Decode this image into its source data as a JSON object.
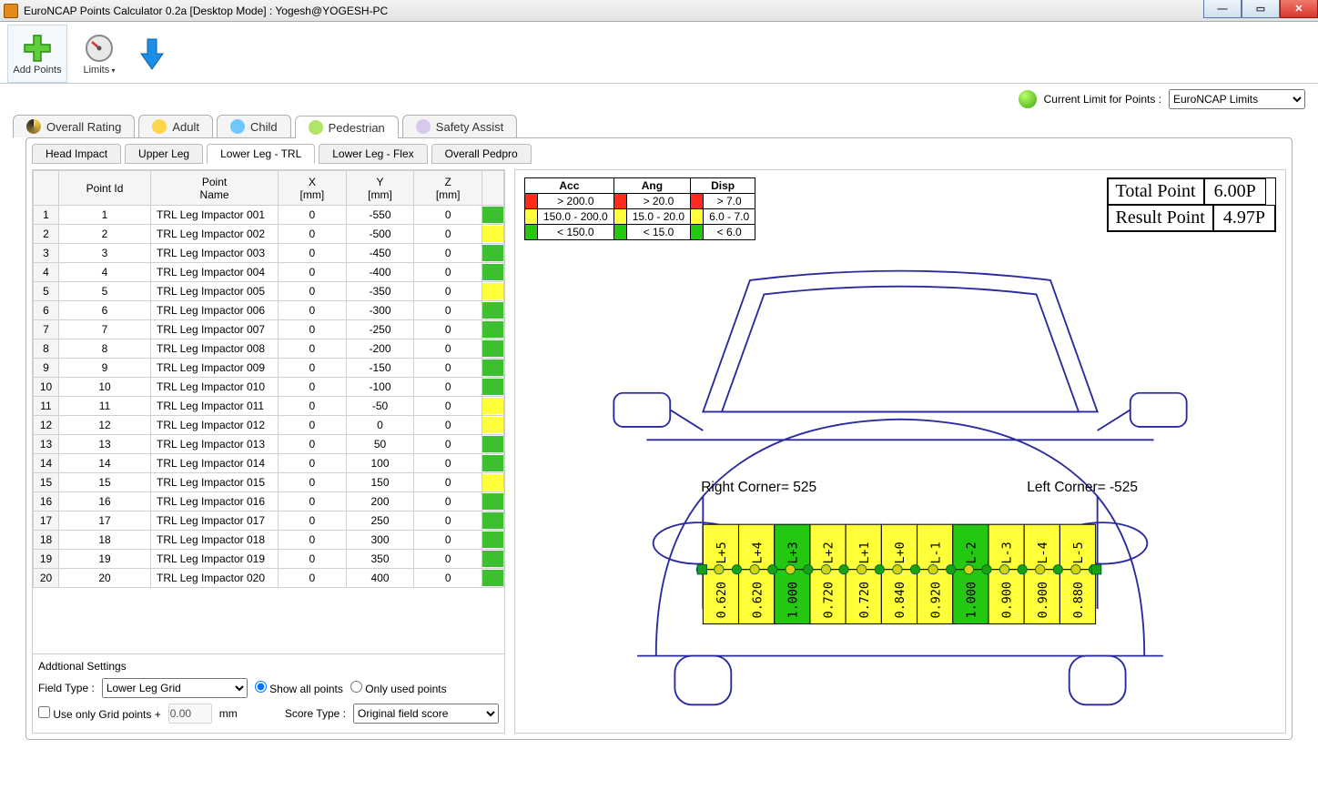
{
  "window": {
    "title": "EuroNCAP Points Calculator 0.2a [Desktop Mode] : Yogesh@YOGESH-PC"
  },
  "toolbar": {
    "add_points": "Add Points",
    "limits": "Limits"
  },
  "limit_row": {
    "label": "Current Limit for Points :",
    "selected": "EuroNCAP Limits"
  },
  "tabs": {
    "overall": "Overall Rating",
    "adult": "Adult",
    "child": "Child",
    "pedestrian": "Pedestrian",
    "safety": "Safety Assist"
  },
  "subtabs": {
    "head": "Head Impact",
    "upper": "Upper Leg",
    "trl": "Lower Leg - TRL",
    "flex": "Lower Leg - Flex",
    "overallp": "Overall Pedpro"
  },
  "table": {
    "headers": {
      "pid": "Point Id",
      "pname": "Point\nName",
      "x": "X\n[mm]",
      "y": "Y\n[mm]",
      "z": "Z\n[mm]"
    },
    "rows": [
      {
        "n": 1,
        "id": "1",
        "name": "TRL Leg Impactor 001",
        "x": "0",
        "y": "-550",
        "z": "0",
        "c": "g"
      },
      {
        "n": 2,
        "id": "2",
        "name": "TRL Leg Impactor 002",
        "x": "0",
        "y": "-500",
        "z": "0",
        "c": "y"
      },
      {
        "n": 3,
        "id": "3",
        "name": "TRL Leg Impactor 003",
        "x": "0",
        "y": "-450",
        "z": "0",
        "c": "g"
      },
      {
        "n": 4,
        "id": "4",
        "name": "TRL Leg Impactor 004",
        "x": "0",
        "y": "-400",
        "z": "0",
        "c": "g"
      },
      {
        "n": 5,
        "id": "5",
        "name": "TRL Leg Impactor 005",
        "x": "0",
        "y": "-350",
        "z": "0",
        "c": "y"
      },
      {
        "n": 6,
        "id": "6",
        "name": "TRL Leg Impactor 006",
        "x": "0",
        "y": "-300",
        "z": "0",
        "c": "g"
      },
      {
        "n": 7,
        "id": "7",
        "name": "TRL Leg Impactor 007",
        "x": "0",
        "y": "-250",
        "z": "0",
        "c": "g"
      },
      {
        "n": 8,
        "id": "8",
        "name": "TRL Leg Impactor 008",
        "x": "0",
        "y": "-200",
        "z": "0",
        "c": "g"
      },
      {
        "n": 9,
        "id": "9",
        "name": "TRL Leg Impactor 009",
        "x": "0",
        "y": "-150",
        "z": "0",
        "c": "g"
      },
      {
        "n": 10,
        "id": "10",
        "name": "TRL Leg Impactor 010",
        "x": "0",
        "y": "-100",
        "z": "0",
        "c": "g"
      },
      {
        "n": 11,
        "id": "11",
        "name": "TRL Leg Impactor 011",
        "x": "0",
        "y": "-50",
        "z": "0",
        "c": "y"
      },
      {
        "n": 12,
        "id": "12",
        "name": "TRL Leg Impactor 012",
        "x": "0",
        "y": "0",
        "z": "0",
        "c": "y"
      },
      {
        "n": 13,
        "id": "13",
        "name": "TRL Leg Impactor 013",
        "x": "0",
        "y": "50",
        "z": "0",
        "c": "g"
      },
      {
        "n": 14,
        "id": "14",
        "name": "TRL Leg Impactor 014",
        "x": "0",
        "y": "100",
        "z": "0",
        "c": "g"
      },
      {
        "n": 15,
        "id": "15",
        "name": "TRL Leg Impactor 015",
        "x": "0",
        "y": "150",
        "z": "0",
        "c": "y"
      },
      {
        "n": 16,
        "id": "16",
        "name": "TRL Leg Impactor 016",
        "x": "0",
        "y": "200",
        "z": "0",
        "c": "g"
      },
      {
        "n": 17,
        "id": "17",
        "name": "TRL Leg Impactor 017",
        "x": "0",
        "y": "250",
        "z": "0",
        "c": "g"
      },
      {
        "n": 18,
        "id": "18",
        "name": "TRL Leg Impactor 018",
        "x": "0",
        "y": "300",
        "z": "0",
        "c": "g"
      },
      {
        "n": 19,
        "id": "19",
        "name": "TRL Leg Impactor 019",
        "x": "0",
        "y": "350",
        "z": "0",
        "c": "g"
      },
      {
        "n": 20,
        "id": "20",
        "name": "TRL Leg Impactor 020",
        "x": "0",
        "y": "400",
        "z": "0",
        "c": "g"
      }
    ]
  },
  "settings": {
    "title": "Addtional Settings",
    "field_type_label": "Field Type  :",
    "field_type_value": "Lower Leg Grid",
    "show_all": "Show all points",
    "only_used": "Only used points",
    "use_grid": "Use only Grid points +",
    "grid_val": "0.00",
    "mm": "mm",
    "score_type_label": "Score Type :",
    "score_type_value": "Original field score"
  },
  "legend": {
    "h1": "Acc",
    "h2": "Ang",
    "h3": "Disp",
    "r1a": "> 200.0",
    "r1b": "> 20.0",
    "r1c": "> 7.0",
    "r2a": "150.0 - 200.0",
    "r2b": "15.0 - 20.0",
    "r2c": "6.0 - 7.0",
    "r3a": "< 150.0",
    "r3b": "< 15.0",
    "r3c": "< 6.0"
  },
  "points": {
    "tpl": "Total Point",
    "tpv": "6.00P",
    "rpl": "Result Point",
    "rpv": "4.97P"
  },
  "diagram": {
    "right_corner": "Right Corner= 525",
    "left_corner": "Left Corner= -525",
    "cells": [
      {
        "label": "L+5",
        "val": "0.620",
        "c": "y"
      },
      {
        "label": "L+4",
        "val": "0.620",
        "c": "y"
      },
      {
        "label": "L+3",
        "val": "1.000",
        "c": "g"
      },
      {
        "label": "L+2",
        "val": "0.720",
        "c": "y"
      },
      {
        "label": "L+1",
        "val": "0.720",
        "c": "y"
      },
      {
        "label": "L+0",
        "val": "0.840",
        "c": "y"
      },
      {
        "label": "L-1",
        "val": "0.920",
        "c": "y"
      },
      {
        "label": "L-2",
        "val": "1.000",
        "c": "g"
      },
      {
        "label": "L-3",
        "val": "0.900",
        "c": "y"
      },
      {
        "label": "L-4",
        "val": "0.900",
        "c": "y"
      },
      {
        "label": "L-5",
        "val": "0.880",
        "c": "y"
      }
    ]
  }
}
